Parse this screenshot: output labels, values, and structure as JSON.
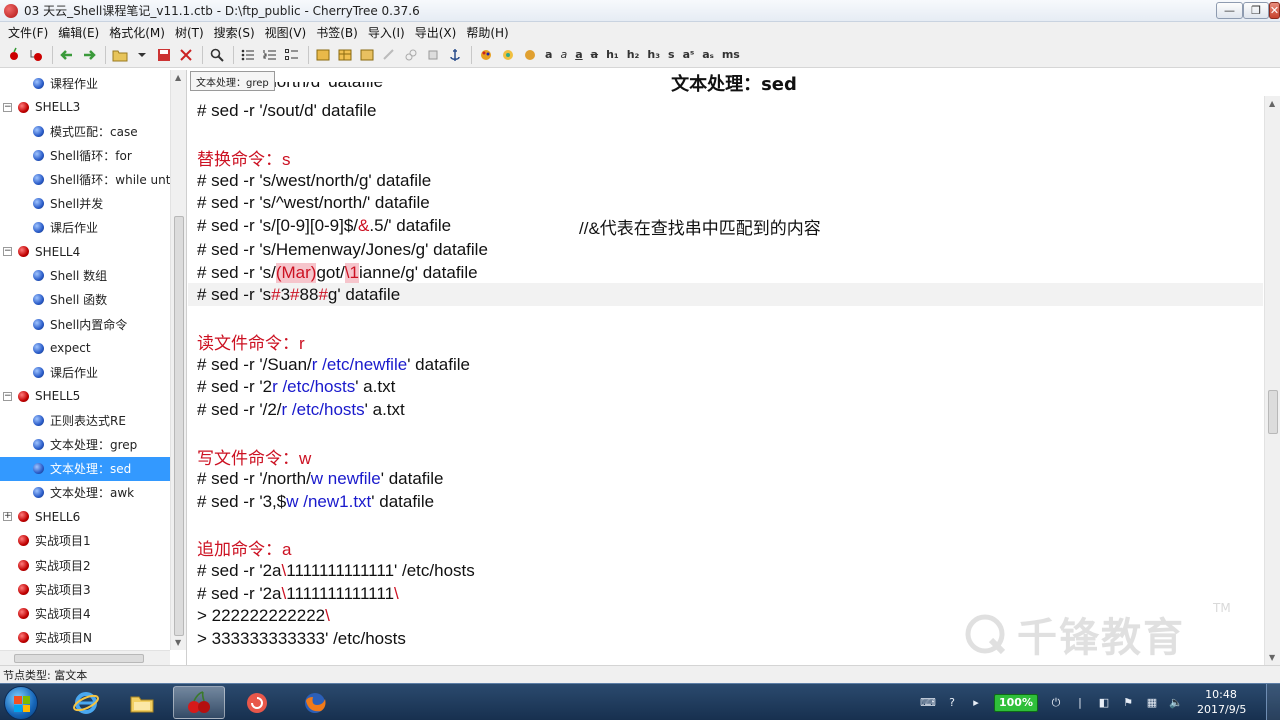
{
  "window": {
    "title": "03 天云_Shell课程笔记_v11.1.ctb - D:\\ftp_public - CherryTree 0.37.6",
    "minimize_glyph": "—",
    "maximize_glyph": "❐",
    "close_glyph": "✕"
  },
  "menu": [
    "文件(F)",
    "编辑(E)",
    "格式化(M)",
    "树(T)",
    "搜索(S)",
    "视图(V)",
    "书签(B)",
    "导入(I)",
    "导出(X)",
    "帮助(H)"
  ],
  "toolbar": {
    "text_buttons": [
      "a",
      "a",
      "a",
      "a",
      "h₁",
      "h₂",
      "h₃",
      "s",
      "aˢ",
      "aₛ",
      "ms"
    ]
  },
  "tree": {
    "items": [
      {
        "label": "课程作业",
        "level": 1,
        "selected": false
      },
      {
        "label": "SHELL3",
        "level": 0,
        "expander": "−"
      },
      {
        "label": "模式匹配：case",
        "level": 1
      },
      {
        "label": "Shell循环：for",
        "level": 1
      },
      {
        "label": "Shell循环：while until",
        "level": 1
      },
      {
        "label": "Shell并发",
        "level": 1
      },
      {
        "label": "课后作业",
        "level": 1
      },
      {
        "label": "SHELL4",
        "level": 0,
        "expander": "−"
      },
      {
        "label": "Shell 数组",
        "level": 1
      },
      {
        "label": "Shell 函数",
        "level": 1
      },
      {
        "label": "Shell内置命令",
        "level": 1
      },
      {
        "label": "expect",
        "level": 1
      },
      {
        "label": "课后作业",
        "level": 1
      },
      {
        "label": "SHELL5",
        "level": 0,
        "expander": "−"
      },
      {
        "label": "正则表达式RE",
        "level": 1
      },
      {
        "label": "文本处理：grep",
        "level": 1
      },
      {
        "label": "文本处理：sed",
        "level": 1,
        "selected": true
      },
      {
        "label": "文本处理：awk",
        "level": 1
      },
      {
        "label": "SHELL6",
        "level": 0,
        "expander": "+"
      },
      {
        "label": "实战项目1",
        "level": 0
      },
      {
        "label": "实战项目2",
        "level": 0
      },
      {
        "label": "实战项目3",
        "level": 0
      },
      {
        "label": "实战项目4",
        "level": 0
      },
      {
        "label": "实战项目N",
        "level": 0
      }
    ]
  },
  "tooltip": "文本处理：grep",
  "editor": {
    "node_title": "文本处理：sed",
    "partial_line": "# sed -r '/north/d' datafile",
    "line_sout": "# sed -r '/sout/d' datafile",
    "h_replace": "替换命令：s",
    "s1": "# sed -r 's/west/north/g' datafile",
    "s2": "# sed -r 's/^west/north/' datafile",
    "s3a": "# sed -r 's/[0-9][0-9]$/",
    "s3b": "&",
    "s3c": ".5/' datafile",
    "s3comment": "//&代表在查找串中匹配到的内容",
    "s4": "# sed -r 's/Hemenway/Jones/g' datafile",
    "s5a": "# sed -r 's/",
    "s5b": "(Mar)",
    "s5c": "got/",
    "s5d": "\\1",
    "s5e": "ianne/g' datafile",
    "s6a": "# sed -r 's",
    "s6b": "#",
    "s6c": "3",
    "s6d": "#",
    "s6e": "88",
    "s6f": "#",
    "s6g": "g' datafile",
    "h_read": "读文件命令：r",
    "r1a": "# sed -r '/Suan/",
    "r1b": "r /etc/newfile",
    "r1c": "' datafile",
    "r2a": "# sed -r '2",
    "r2b": "r /etc/hosts",
    "r2c": "' a.txt",
    "r3a": "# sed -r '/2/",
    "r3b": "r /etc/hosts",
    "r3c": "' a.txt",
    "h_write": "写文件命令：w",
    "w1a": "# sed -r '/north/",
    "w1b": "w newfile",
    "w1c": "' datafile",
    "w2a": "# sed -r '3,$",
    "w2b": "w /new1.txt",
    "w2c": "' datafile",
    "h_append": "追加命令：a",
    "a1a": "# sed -r '2a",
    "a1b": "\\",
    "a1c": "1111111111111' /etc/hosts",
    "a2a": "# sed -r '2a",
    "a2b": "\\",
    "a2c": "1111111111111",
    "a2d": "\\",
    "a3a": "> 222222222222",
    "a3b": "\\",
    "a4": "> 333333333333' /etc/hosts"
  },
  "watermark": {
    "text": "千锋教育",
    "tm": "TM"
  },
  "statusbar": "节点类型: 富文本",
  "taskbar": {
    "battery": "100%",
    "time": "10:48",
    "date": "2017/9/5"
  },
  "colors": {
    "selection": "#3399ff",
    "heading": "#cc1122",
    "command_blue": "#1a1acc"
  }
}
